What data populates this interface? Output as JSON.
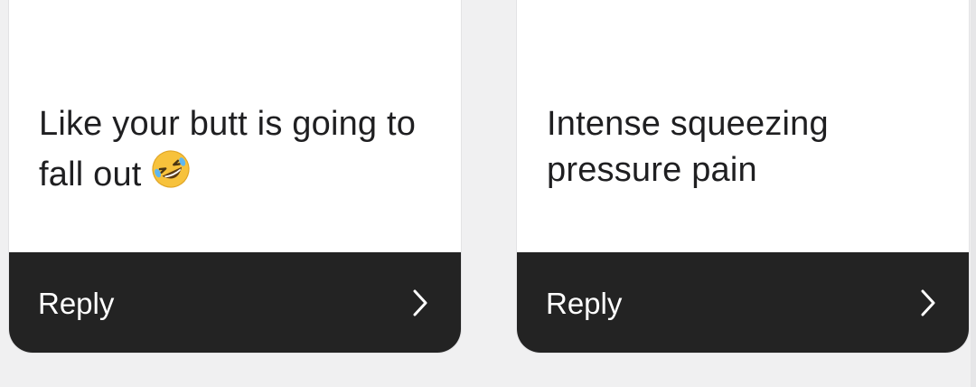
{
  "cards": [
    {
      "text": "Like your butt is going to fall out",
      "emoji_icon": "rolling-on-floor-laughing-emoji",
      "reply_label": "Reply",
      "chevron_icon": "chevron-right-icon"
    },
    {
      "text": "Intense squeezing pressure pain",
      "reply_label": "Reply",
      "chevron_icon": "chevron-right-icon"
    }
  ],
  "colors": {
    "card_background": "#ffffff",
    "reply_bar": "#232323",
    "text": "#1f1f21",
    "page_background": "#f0f0f1"
  }
}
